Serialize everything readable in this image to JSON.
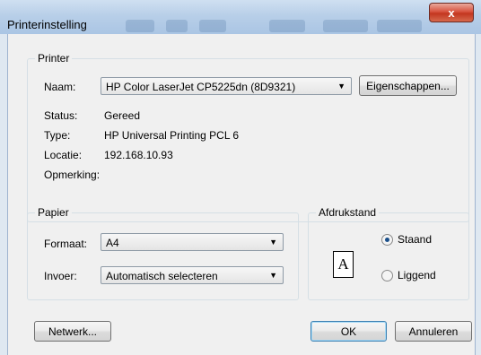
{
  "window": {
    "title": "Printerinstelling",
    "close_glyph": "x"
  },
  "printer": {
    "legend": "Printer",
    "name_label": "Naam:",
    "name_value": "HP Color LaserJet CP5225dn (8D9321)",
    "properties_button": "Eigenschappen...",
    "status_label": "Status:",
    "status_value": "Gereed",
    "type_label": "Type:",
    "type_value": "HP Universal Printing PCL 6",
    "location_label": "Locatie:",
    "location_value": "192.168.10.93",
    "comment_label": "Opmerking:",
    "comment_value": ""
  },
  "paper": {
    "legend": "Papier",
    "format_label": "Formaat:",
    "format_value": "A4",
    "source_label": "Invoer:",
    "source_value": "Automatisch selecteren"
  },
  "orientation": {
    "legend": "Afdrukstand",
    "icon_letter": "A",
    "portrait_label": "Staand",
    "landscape_label": "Liggend",
    "selected": "Staand"
  },
  "buttons": {
    "network": "Netwerk...",
    "ok": "OK",
    "cancel": "Annuleren"
  },
  "icons": {
    "dropdown": "▼",
    "close": "close-icon"
  }
}
